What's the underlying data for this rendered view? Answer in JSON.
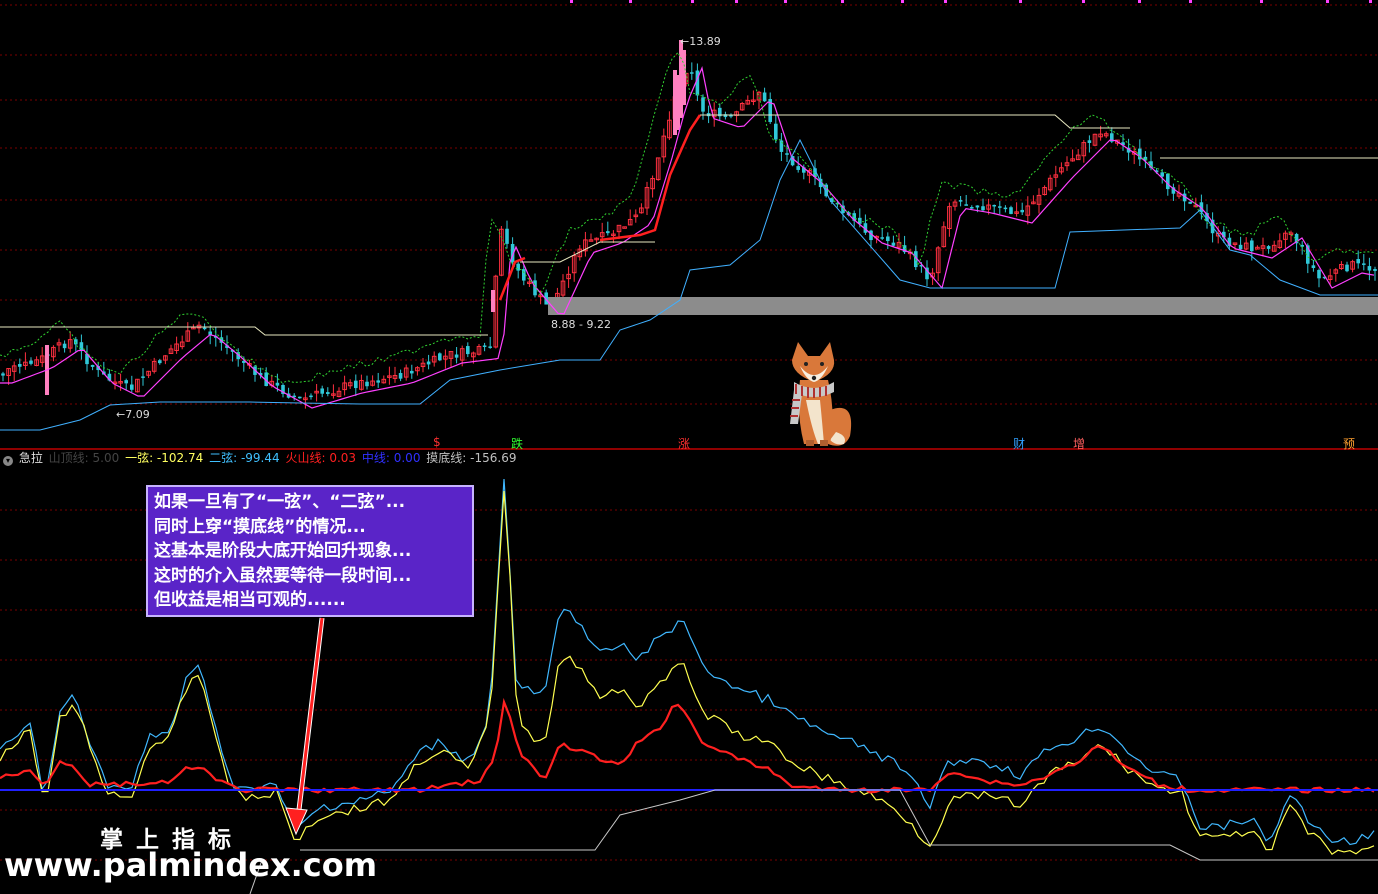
{
  "price_labels": {
    "high": "13.89",
    "low": "7.09",
    "box": "8.88 - 9.22"
  },
  "signals": [
    {
      "text": "$",
      "color": "#ff3030"
    },
    {
      "text": "跌",
      "color": "#30ff30"
    },
    {
      "text": "涨",
      "color": "#ff3030"
    },
    {
      "text": "财",
      "color": "#30a0ff"
    },
    {
      "text": "增",
      "color": "#ff6060"
    },
    {
      "text": "预",
      "color": "#ffa030"
    }
  ],
  "indicator": {
    "name": "急拉",
    "items": [
      {
        "label": "山顶线: 5.00",
        "color": "#444444"
      },
      {
        "label": "一弦: -102.74",
        "color": "#ffff60"
      },
      {
        "label": "二弦: -99.44",
        "color": "#40c0ff"
      },
      {
        "label": "火山线: 0.03",
        "color": "#ff2020"
      },
      {
        "label": "中线: 0.00",
        "color": "#3030ff"
      },
      {
        "label": "摸底线: -156.69",
        "color": "#c0c0c0"
      }
    ]
  },
  "annotation": [
    "如果一旦有了“一弦”、“二弦”...",
    "同时上穿“摸底线”的情况...",
    "这基本是阶段大底开始回升现象...",
    "这时的介入虽然要等待一段时间...",
    "但收益是相当可观的......"
  ],
  "watermark": {
    "cn": "掌上指标",
    "url": "www.palmindex.com"
  },
  "colors": {
    "up": "#ff3040",
    "down": "#30c8d8",
    "ma": "#ff40ff",
    "box": "#8c8c8c",
    "grid": "#7a0000",
    "divider": "#c00000"
  }
}
